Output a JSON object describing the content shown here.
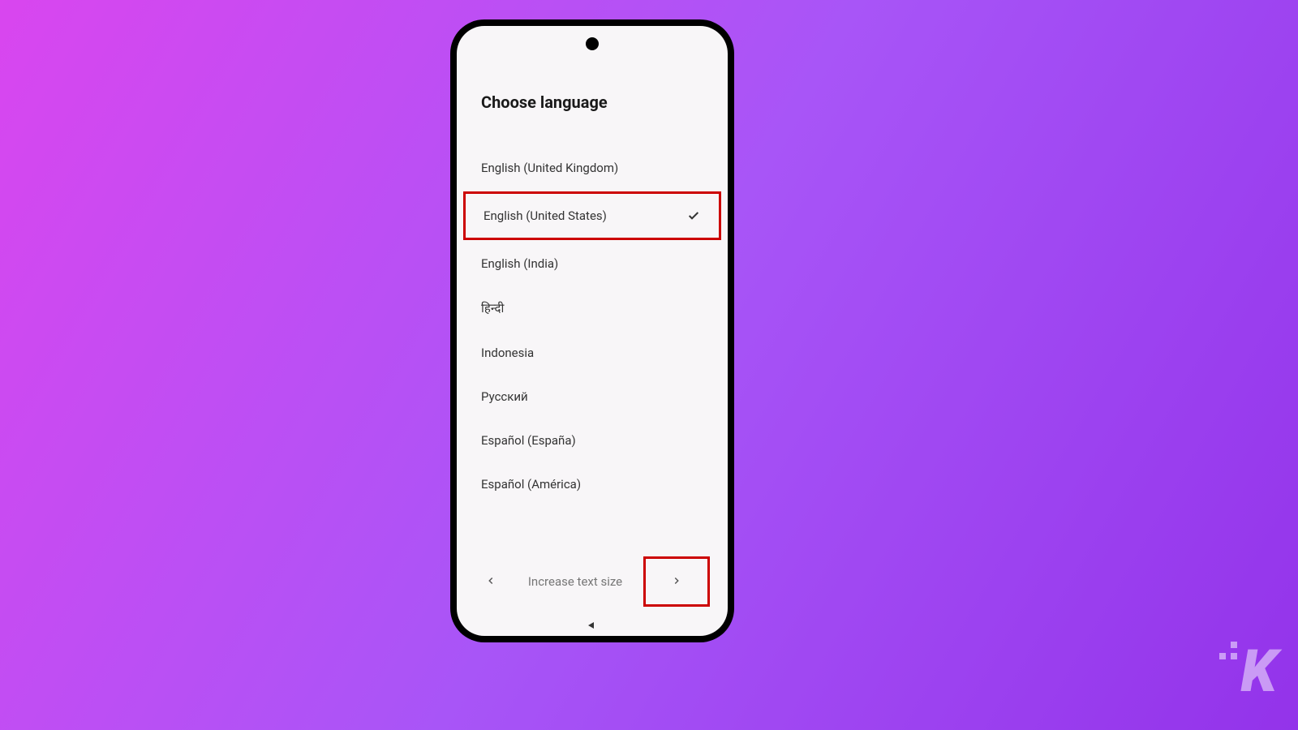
{
  "screen": {
    "title": "Choose language",
    "languages": [
      {
        "label": "English (United Kingdom)",
        "selected": false,
        "highlighted": false
      },
      {
        "label": "English (United States)",
        "selected": true,
        "highlighted": true
      },
      {
        "label": "English (India)",
        "selected": false,
        "highlighted": false
      },
      {
        "label": "हिन्दी",
        "selected": false,
        "highlighted": false
      },
      {
        "label": "Indonesia",
        "selected": false,
        "highlighted": false
      },
      {
        "label": "Русский",
        "selected": false,
        "highlighted": false
      },
      {
        "label": "Español (España)",
        "selected": false,
        "highlighted": false
      },
      {
        "label": "Español (América)",
        "selected": false,
        "highlighted": false
      }
    ],
    "bottom_label": "Increase text size",
    "next_highlighted": true
  },
  "watermark": "K"
}
